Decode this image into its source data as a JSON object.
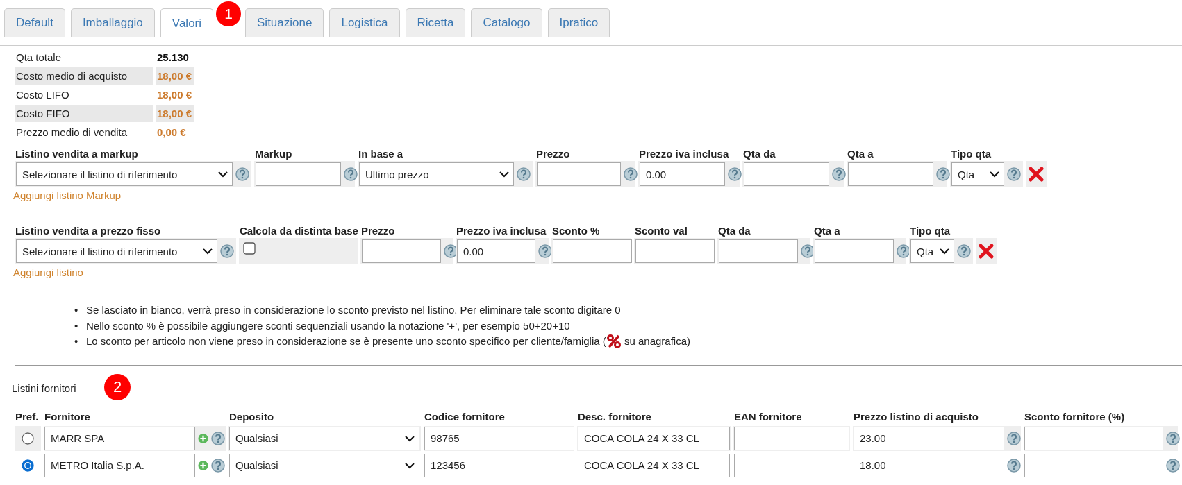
{
  "tabs": [
    {
      "label": "Default",
      "selected": false
    },
    {
      "label": "Imballaggio",
      "selected": false
    },
    {
      "label": "Valori",
      "selected": true
    },
    {
      "label": "Situazione",
      "selected": false
    },
    {
      "label": "Logistica",
      "selected": false
    },
    {
      "label": "Ricetta",
      "selected": false
    },
    {
      "label": "Catalogo",
      "selected": false
    },
    {
      "label": "Ipratico",
      "selected": false
    }
  ],
  "tab_callout": "1",
  "stats": [
    {
      "label": "Qta totale",
      "value": "25.130",
      "kind": "quantity",
      "shaded": false
    },
    {
      "label": "Costo medio di acquisto",
      "value": "18,00 €",
      "kind": "money",
      "shaded": true
    },
    {
      "label": "Costo LIFO",
      "value": "18,00 €",
      "kind": "money",
      "shaded": false
    },
    {
      "label": "Costo FIFO",
      "value": "18,00 €",
      "kind": "money",
      "shaded": true
    },
    {
      "label": "Prezzo medio di vendita",
      "value": "0,00 €",
      "kind": "money",
      "shaded": false
    }
  ],
  "markup": {
    "columns": [
      "Listino vendita a markup",
      "Markup",
      "In base a",
      "Prezzo",
      "Prezzo iva inclusa",
      "Qta da",
      "Qta a",
      "Tipo qta"
    ],
    "fields": [
      {
        "kind": "select",
        "value": "Selezionare il listino di riferimento",
        "help": true
      },
      {
        "kind": "input",
        "help": true
      },
      {
        "kind": "select",
        "value": "Ultimo prezzo",
        "help": true
      },
      {
        "kind": "input",
        "help": true
      },
      {
        "kind": "input",
        "value": "0.00",
        "help": true
      },
      {
        "kind": "input",
        "help": true
      },
      {
        "kind": "input",
        "help": true
      },
      {
        "kind": "select",
        "value": "Qta",
        "help": true
      },
      {
        "kind": "delete"
      }
    ],
    "add_link": "Aggiungi listino Markup"
  },
  "fixed": {
    "columns": [
      "Listino vendita a prezzo fisso",
      "Calcola da distinta base",
      "Prezzo",
      "Prezzo iva inclusa",
      "Sconto %",
      "Sconto val",
      "Qta da",
      "Qta a",
      "Tipo qta"
    ],
    "fields": [
      {
        "kind": "select",
        "value": "Selezionare il listino di riferimento",
        "help": true
      },
      {
        "kind": "checkbox",
        "checked": false
      },
      {
        "kind": "input",
        "help": true
      },
      {
        "kind": "input",
        "value": "0.00",
        "help": true
      },
      {
        "kind": "input",
        "help": false
      },
      {
        "kind": "input",
        "help": false
      },
      {
        "kind": "input",
        "help": true
      },
      {
        "kind": "input",
        "help": true
      },
      {
        "kind": "select",
        "value": "Qta",
        "help": true
      },
      {
        "kind": "delete"
      }
    ],
    "add_link": "Aggiungi listino"
  },
  "notes": [
    {
      "marker": "•",
      "text": "Se lasciato in bianco, verrà preso in considerazione lo sconto previsto nel listino. Per eliminare tale sconto digitare 0"
    },
    {
      "marker": "•",
      "text": "Nello sconto % è possibile aggiungere sconti sequenziali usando la notazione '+', per esempio 50+20+10"
    },
    {
      "marker": "•",
      "text": "Lo sconto per articolo non viene preso in considerazione se è presente uno sconto specifico per cliente/famiglia (",
      "text_after": " su anagrafica)"
    }
  ],
  "suppliers": {
    "title": "Listini fornitori",
    "callout": "2",
    "columns": [
      "Pref.",
      "Fornitore",
      "Deposito",
      "Codice fornitore",
      "Desc. fornitore",
      "EAN fornitore",
      "Prezzo listino di acquisto",
      "Sconto fornitore (%)"
    ],
    "rows": [
      {
        "selected": false,
        "fornitore": "MARR SPA",
        "deposito": "Qualsiasi",
        "codice": "98765",
        "descrizione": "COCA COLA 24 X 33 CL",
        "prezzo": "23.00"
      },
      {
        "selected": true,
        "fornitore": "METRO Italia S.p.A.",
        "deposito": "Qualsiasi",
        "codice": "123456",
        "descrizione": "COCA COLA 24 X 33 CL",
        "prezzo": "18.00"
      }
    ]
  }
}
